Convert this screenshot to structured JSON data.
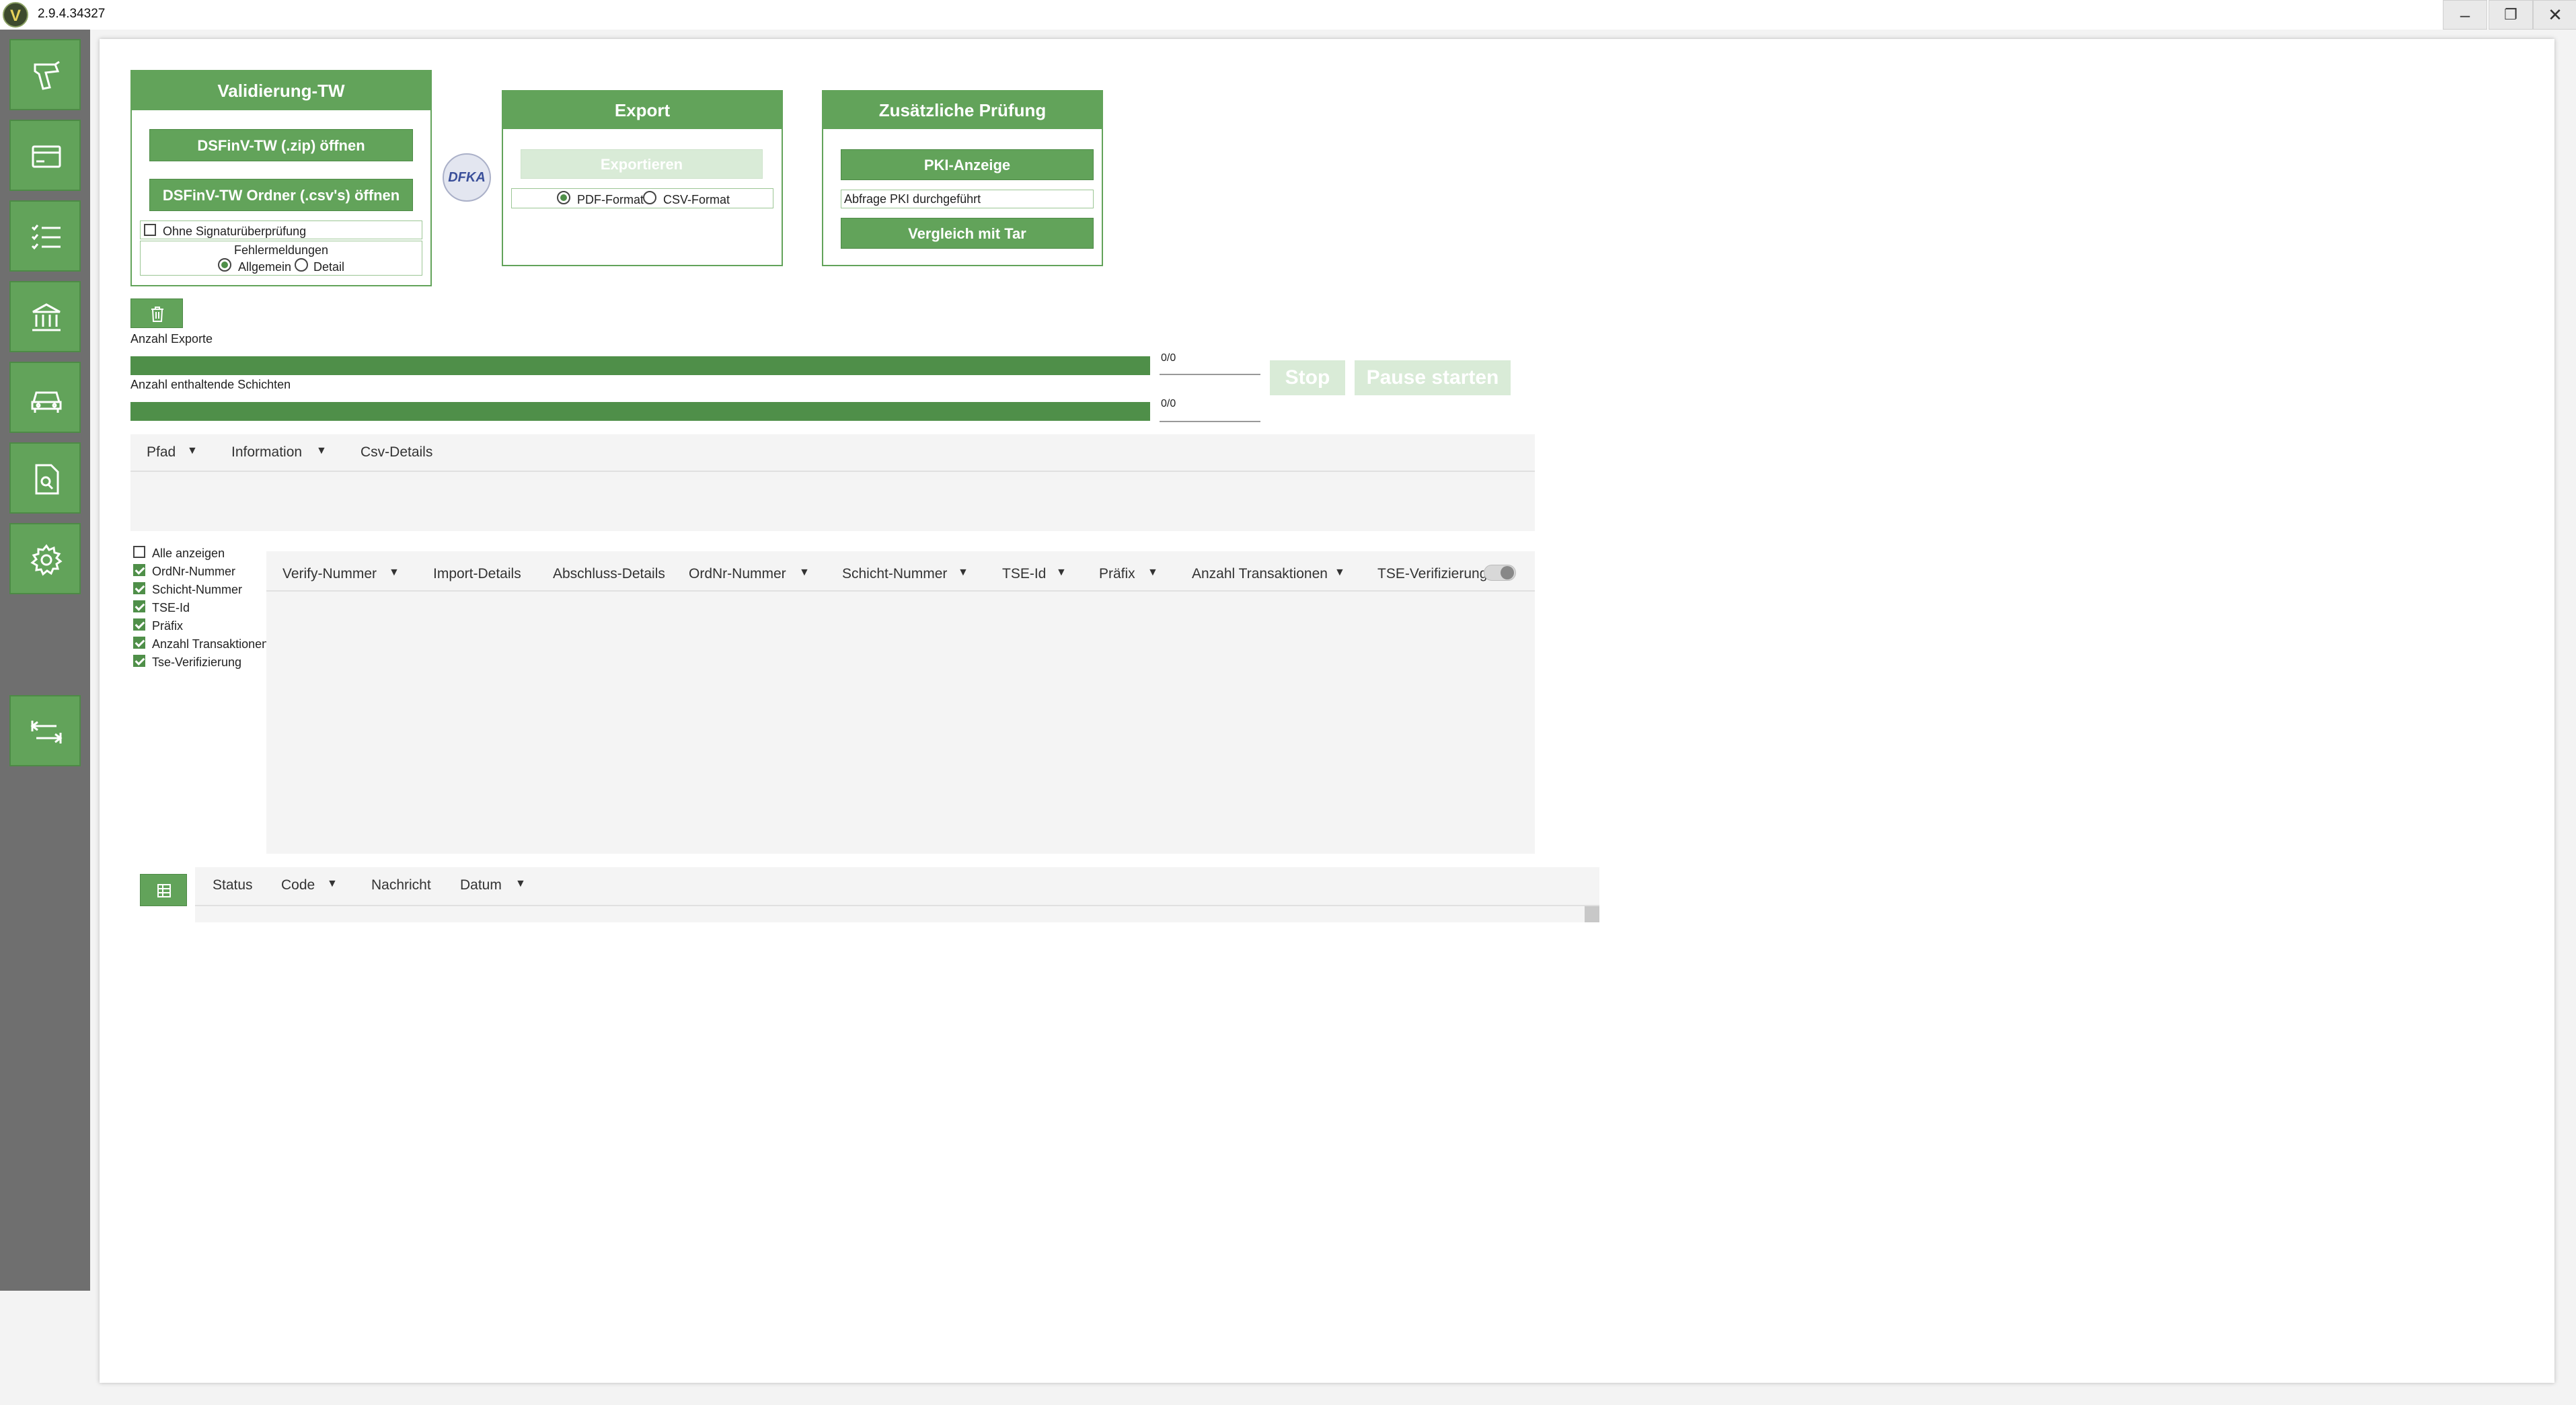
{
  "window": {
    "version": "2.9.4.34327",
    "logo_letter": "V",
    "minimize": "–",
    "restore": "❐",
    "close": "✕"
  },
  "colors": {
    "accent": "#62a35a",
    "accent_dark": "#4f8f49",
    "sidebar": "#6f6f6f"
  },
  "sidebar": {
    "items": [
      {
        "icon": "scanner-icon"
      },
      {
        "icon": "card-icon"
      },
      {
        "icon": "checklist-icon"
      },
      {
        "icon": "bank-icon"
      },
      {
        "icon": "car-icon"
      },
      {
        "icon": "document-search-icon"
      },
      {
        "icon": "gear-icon"
      },
      {
        "icon": "collapse-arrows-icon"
      }
    ]
  },
  "validation": {
    "title": "Validierung-TW",
    "open_zip": "DSFinV-TW (.zip) öffnen",
    "open_folder": "DSFinV-TW Ordner (.csv's) öffnen",
    "skip_signature": "Ohne Signaturüberprüfung",
    "errors_label": "Fehlermeldungen",
    "opt_general": "Allgemein",
    "opt_detail": "Detail"
  },
  "dfka_logo": "DFKA",
  "export": {
    "title": "Export",
    "export_button": "Exportieren",
    "pdf": "PDF-Format",
    "csv": "CSV-Format"
  },
  "extra": {
    "title": "Zusätzliche Prüfung",
    "pki_button": "PKI-Anzeige",
    "pki_status": "Abfrage PKI durchgeführt",
    "compare_button": "Vergleich mit Tar"
  },
  "progress": {
    "exports_label": "Anzahl Exporte",
    "exports_count": "0/0",
    "exports_fraction": 1.0,
    "shifts_label": "Anzahl enthaltende Schichten",
    "shifts_count": "0/0",
    "shifts_fraction": 1.0,
    "stop": "Stop",
    "pause": "Pause starten"
  },
  "file_table": {
    "columns": [
      "Pfad",
      "Information",
      "Csv-Details"
    ]
  },
  "column_toggles": {
    "items": [
      {
        "label": "Alle anzeigen",
        "checked": false
      },
      {
        "label": "OrdNr-Nummer",
        "checked": true
      },
      {
        "label": "Schicht-Nummer",
        "checked": true
      },
      {
        "label": "TSE-Id",
        "checked": true
      },
      {
        "label": "Präfix",
        "checked": true
      },
      {
        "label": "Anzahl Transaktionen",
        "checked": true
      },
      {
        "label": "Tse-Verifizierung",
        "checked": true
      }
    ]
  },
  "verify_table": {
    "columns": [
      "Verify-Nummer",
      "Import-Details",
      "Abschluss-Details",
      "OrdNr-Nummer",
      "Schicht-Nummer",
      "TSE-Id",
      "Präfix",
      "Anzahl Transaktionen",
      "TSE-Verifizierung"
    ]
  },
  "log_table": {
    "columns": [
      "Status",
      "Code",
      "Nachricht",
      "Datum"
    ]
  }
}
